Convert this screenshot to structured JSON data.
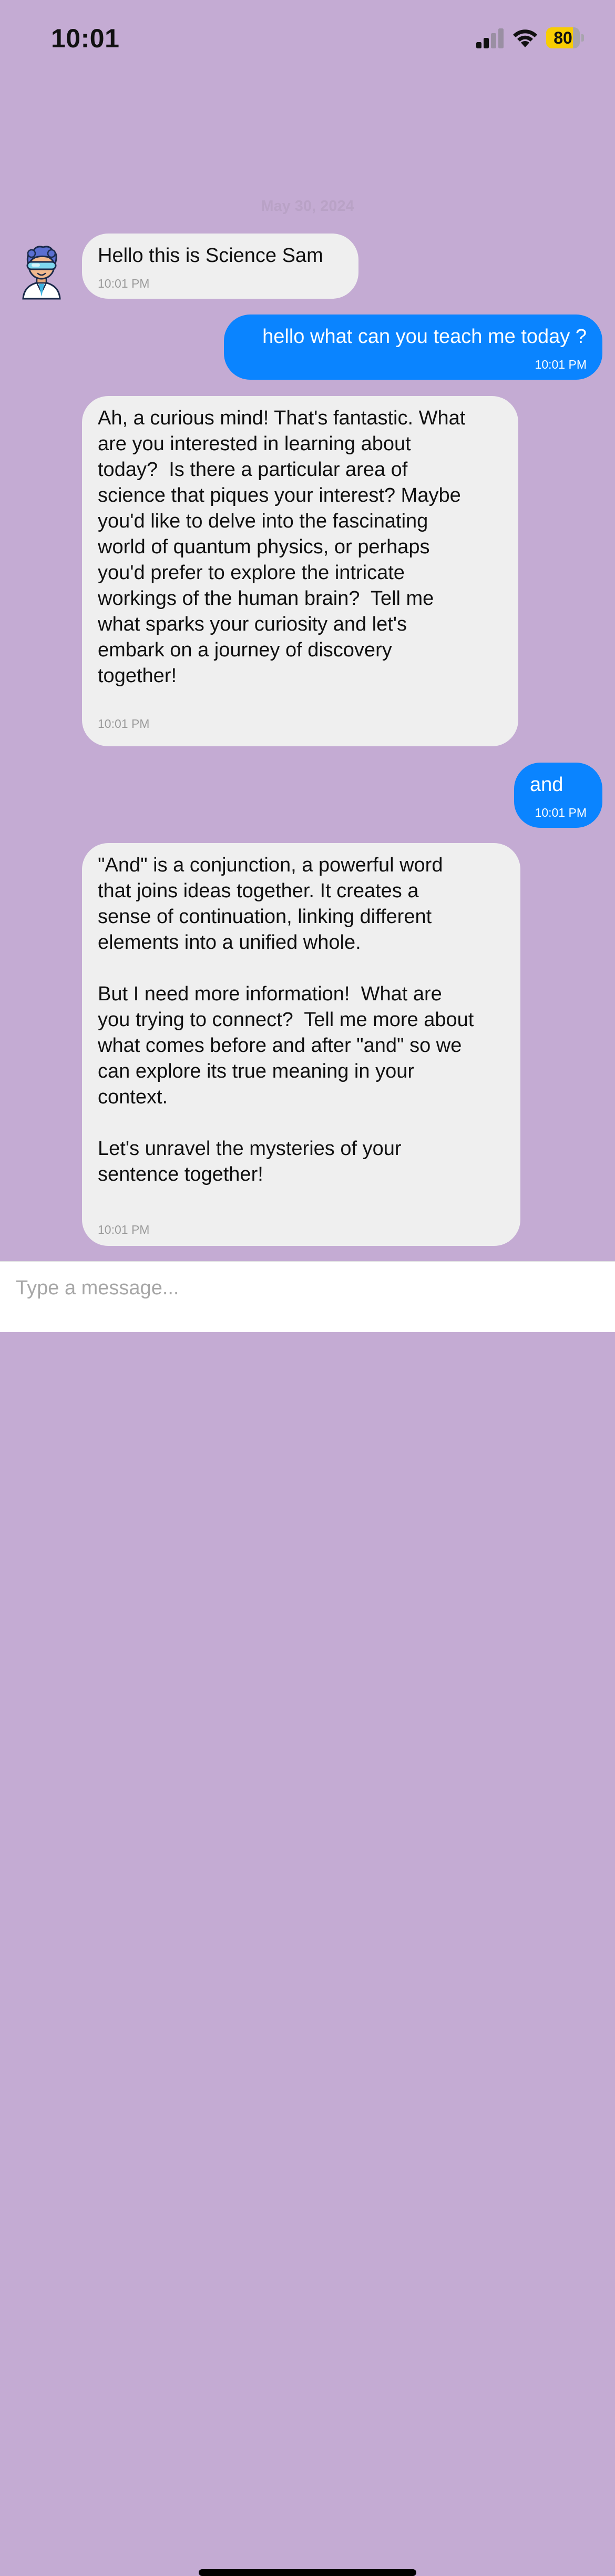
{
  "status_bar": {
    "time": "10:01",
    "battery_level": "80",
    "battery_fraction": 0.8,
    "battery_color": "#f8cd02",
    "icons": [
      "cellular-signal-icon",
      "wifi-icon",
      "battery-icon"
    ]
  },
  "chat": {
    "date_divider": "May 30, 2024",
    "bot_avatar": "scientist-avatar-icon",
    "colors": {
      "background": "#c4abd3",
      "incoming_bubble": "#efefef",
      "outgoing_bubble": "#0a84ff"
    },
    "messages": [
      {
        "sender": "bot",
        "text": "Hello this is  Science Sam",
        "time": "10:01 PM"
      },
      {
        "sender": "user",
        "text": "hello what can you teach me today ?",
        "time": "10:01 PM"
      },
      {
        "sender": "bot",
        "text": "Ah, a curious mind! That's fantastic. What\nare you interested in learning about\ntoday?  Is there a particular area of\nscience that piques your interest? Maybe\nyou'd like to delve into the fascinating\nworld of quantum physics, or perhaps\nyou'd prefer to explore the intricate\nworkings of the human brain?  Tell me\nwhat sparks your curiosity and let's\nembark on a journey of discovery\ntogether!",
        "time": "10:01 PM"
      },
      {
        "sender": "user",
        "text": "and",
        "time": "10:01 PM"
      },
      {
        "sender": "bot",
        "text": "\"And\" is a conjunction, a powerful word\nthat joins ideas together. It creates a\nsense of continuation, linking different\nelements into a unified whole.\n\nBut I need more information!  What are\nyou trying to connect?  Tell me more about\nwhat comes before and after \"and\" so we\ncan explore its true meaning in your\ncontext.\n\nLet's unravel the mysteries of your\nsentence together!",
        "time": "10:01 PM"
      }
    ]
  },
  "composer": {
    "placeholder": "Type a message...",
    "value": ""
  }
}
